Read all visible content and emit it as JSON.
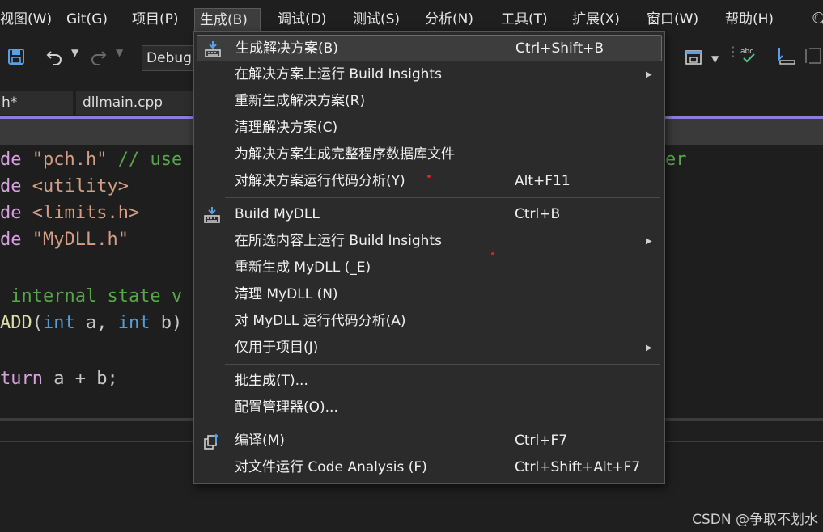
{
  "menubar": {
    "items": [
      "视图(W)",
      "Git(G)",
      "项目(P)",
      "生成(B)",
      "调试(D)",
      "测试(S)",
      "分析(N)",
      "工具(T)",
      "扩展(X)",
      "窗口(W)",
      "帮助(H)"
    ]
  },
  "toolbar": {
    "config": "Debug"
  },
  "tabs": [
    "h*",
    "dllmain.cpp"
  ],
  "editor": {
    "lines": [
      [
        "de ",
        "\"pch.h\"",
        " // use",
        "er"
      ],
      [
        "de ",
        "<utility>"
      ],
      [
        "de ",
        "<limits.h>"
      ],
      [
        "de ",
        "\"MyDLL.h\""
      ],
      [
        "",
        " internal state v"
      ],
      [
        "ADD",
        "(",
        "int",
        " a, ",
        "int",
        " b)"
      ],
      [
        "turn",
        " a + b;"
      ]
    ]
  },
  "menu": {
    "items": [
      {
        "label": "生成解决方案(B)",
        "shortcut": "Ctrl+Shift+B",
        "icon": "build-solution-icon"
      },
      {
        "label": "在解决方案上运行 Build Insights",
        "submenu": true
      },
      {
        "label": "重新生成解决方案(R)"
      },
      {
        "label": "清理解决方案(C)"
      },
      {
        "label": "为解决方案生成完整程序数据库文件"
      },
      {
        "label": "对解决方案运行代码分析(Y)",
        "shortcut": "Alt+F11"
      },
      {
        "label": "Build MyDLL",
        "shortcut": "Ctrl+B",
        "icon": "build-project-icon"
      },
      {
        "label": "在所选内容上运行 Build Insights",
        "submenu": true
      },
      {
        "label": "重新生成 MyDLL (_E)"
      },
      {
        "label": "清理 MyDLL (N)"
      },
      {
        "label": "对 MyDLL 运行代码分析(A)"
      },
      {
        "label": "仅用于项目(J)",
        "submenu": true
      },
      {
        "label": "批生成(T)..."
      },
      {
        "label": "配置管理器(O)..."
      },
      {
        "label": "编译(M)",
        "shortcut": "Ctrl+F7",
        "icon": "compile-icon"
      },
      {
        "label": "对文件运行 Code Analysis (F)",
        "shortcut": "Ctrl+Shift+Alt+F7"
      }
    ]
  },
  "watermark": "CSDN @争取不划水",
  "colors": {
    "accent": "#8c7dd9",
    "highlight": "#3d3d3d",
    "menu_bg": "#2b2b2b"
  }
}
